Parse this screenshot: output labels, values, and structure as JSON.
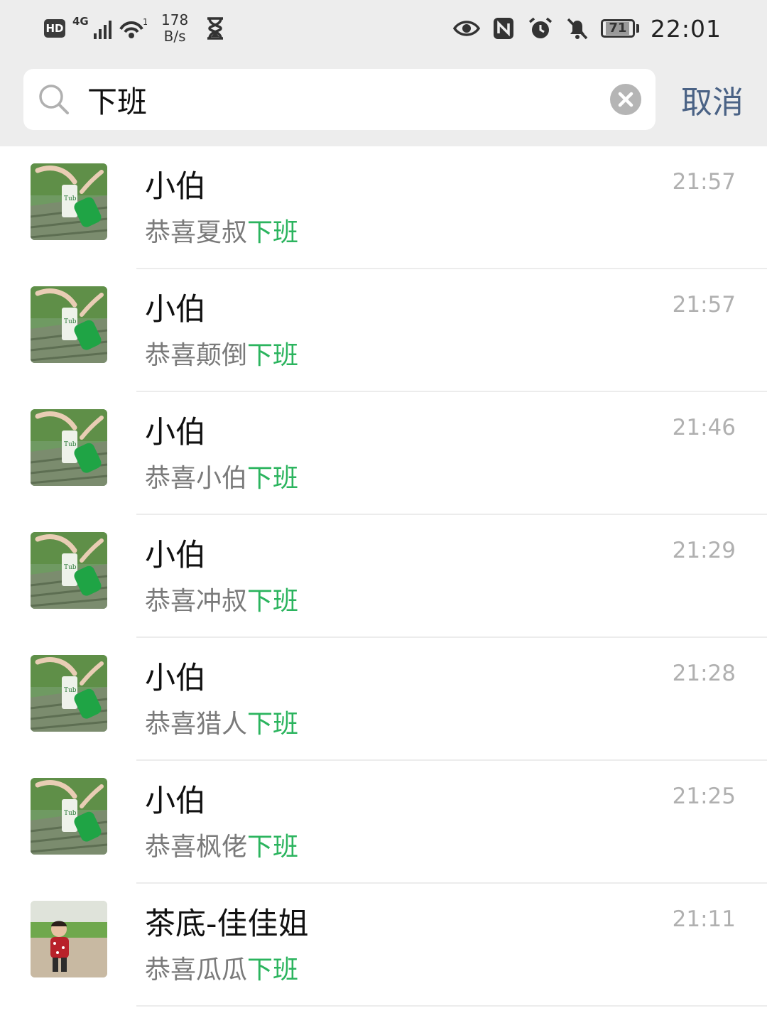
{
  "status_bar": {
    "network_type": "4G",
    "wifi_superscript": "1",
    "speed_value": "178",
    "speed_unit": "B/s",
    "battery": "71",
    "time": "22:01"
  },
  "search": {
    "query": "下班",
    "cancel_label": "取消"
  },
  "highlight_color": "#2bb45e",
  "results": [
    {
      "name": "小伯",
      "message_prefix": "恭喜夏叔",
      "message_match": "下班",
      "time": "21:57",
      "avatar": "green-bottle-photo"
    },
    {
      "name": "小伯",
      "message_prefix": "恭喜颠倒",
      "message_match": "下班",
      "time": "21:57",
      "avatar": "green-bottle-photo"
    },
    {
      "name": "小伯",
      "message_prefix": "恭喜小伯",
      "message_match": "下班",
      "time": "21:46",
      "avatar": "green-bottle-photo"
    },
    {
      "name": "小伯",
      "message_prefix": "恭喜冲叔",
      "message_match": "下班",
      "time": "21:29",
      "avatar": "green-bottle-photo"
    },
    {
      "name": "小伯",
      "message_prefix": "恭喜猎人",
      "message_match": "下班",
      "time": "21:28",
      "avatar": "green-bottle-photo"
    },
    {
      "name": "小伯",
      "message_prefix": "恭喜枫佬",
      "message_match": "下班",
      "time": "21:25",
      "avatar": "green-bottle-photo"
    },
    {
      "name": "茶底-佳佳姐",
      "message_prefix": "恭喜瓜瓜",
      "message_match": "下班",
      "time": "21:11",
      "avatar": "child-in-field-photo"
    }
  ]
}
